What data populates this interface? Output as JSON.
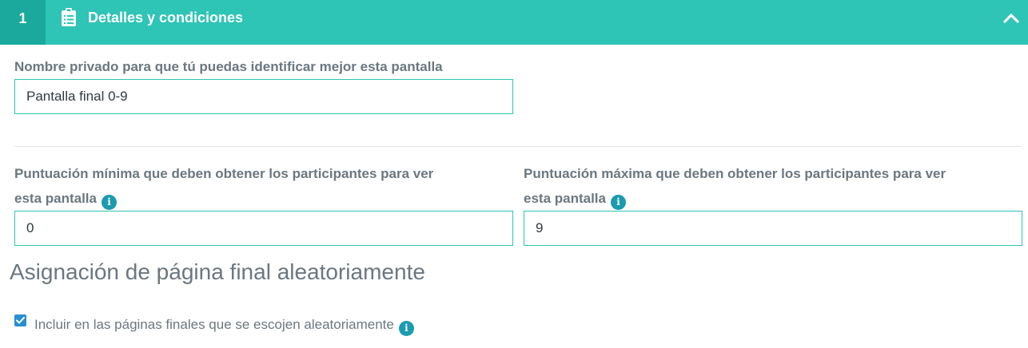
{
  "header": {
    "step_number": "1",
    "title": "Detalles y condiciones",
    "accent_color": "#2ec4b6",
    "step_color": "#1aa99c",
    "icon": "clipboard-icon",
    "toggle_icon": "chevron-up-icon"
  },
  "private_name": {
    "label": "Nombre privado para que tú puedas identificar mejor esta pantalla",
    "value": "Pantalla final 0-9"
  },
  "min_score": {
    "label_line1": "Puntuación mínima que deben obtener los participantes para ver",
    "label_line2": "esta pantalla",
    "value": "0",
    "info_icon": "i"
  },
  "max_score": {
    "label_line1": "Puntuación máxima que deben obtener los participantes para ver",
    "label_line2": "esta pantalla",
    "value": "9",
    "info_icon": "i"
  },
  "random_assignment": {
    "title": "Asignación de página final aleatoriamente",
    "checkbox_label": "Incluir en las páginas finales que se escojen aleatoriamente",
    "checked": true,
    "info_icon": "i"
  }
}
